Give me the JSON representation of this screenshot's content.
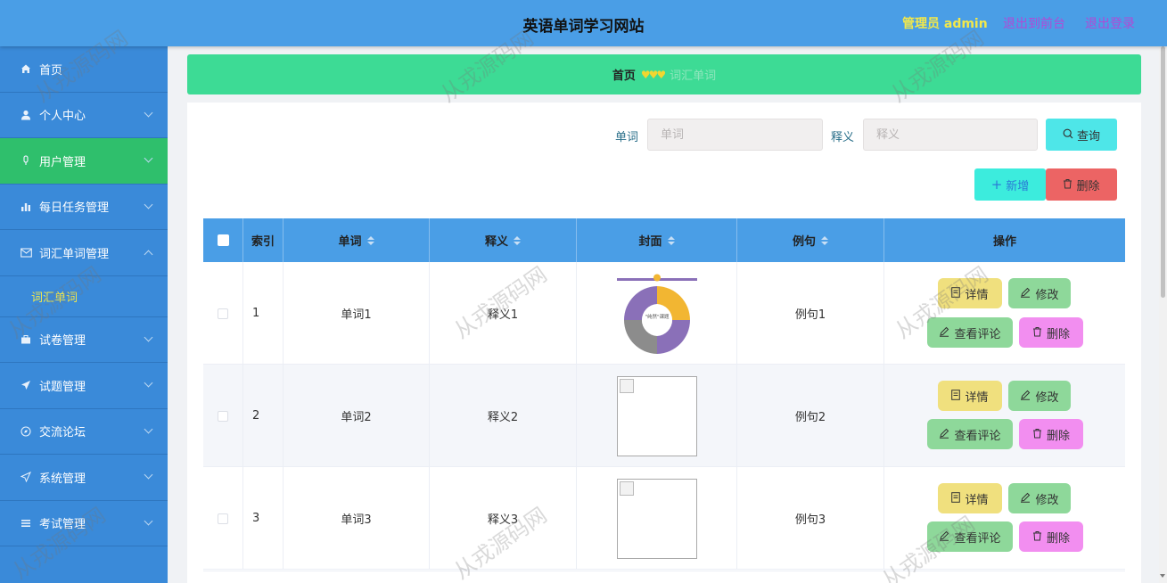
{
  "header": {
    "title": "英语单词学习网站",
    "admin": "管理员 admin",
    "back_front": "退出到前台",
    "logout": "退出登录"
  },
  "sidebar": {
    "items": [
      {
        "label": "首页",
        "icon": "home-icon"
      },
      {
        "label": "个人中心",
        "icon": "user-icon"
      },
      {
        "label": "用户管理",
        "icon": "microphone-icon"
      },
      {
        "label": "每日任务管理",
        "icon": "bar-chart-icon"
      },
      {
        "label": "词汇单词管理",
        "icon": "mail-icon"
      },
      {
        "label": "试卷管理",
        "icon": "briefcase-icon"
      },
      {
        "label": "试题管理",
        "icon": "send-icon"
      },
      {
        "label": "交流论坛",
        "icon": "compass-icon"
      },
      {
        "label": "系统管理",
        "icon": "paper-plane-icon"
      },
      {
        "label": "考试管理",
        "icon": "list-icon"
      }
    ],
    "sub_item": "词汇单词"
  },
  "breadcrumb": {
    "home": "首页",
    "separator": "♥♥♥",
    "current": "词汇单词"
  },
  "search": {
    "word_label": "单词",
    "word_placeholder": "单词",
    "meaning_label": "释义",
    "meaning_placeholder": "释义",
    "query_button": "查询"
  },
  "actions": {
    "add": "新增",
    "delete": "删除"
  },
  "table": {
    "columns": [
      "索引",
      "单词",
      "释义",
      "封面",
      "例句",
      "操作"
    ],
    "rows": [
      {
        "index": "1",
        "word": "单词1",
        "meaning": "释义1",
        "example": "例句1"
      },
      {
        "index": "2",
        "word": "单词2",
        "meaning": "释义2",
        "example": "例句2"
      },
      {
        "index": "3",
        "word": "单词3",
        "meaning": "释义3",
        "example": "例句3"
      }
    ],
    "ops": {
      "detail": "详情",
      "edit": "修改",
      "comments": "查看评论",
      "remove": "删除"
    }
  },
  "cover_image": {
    "center_text": "\"纯然\"课题",
    "colors": [
      "#f2b632",
      "#8a70b8",
      "#8c8c8c"
    ]
  },
  "watermark": "从戎源码网",
  "colors": {
    "header": "#4a9ee6",
    "sidebar": "#3a8ad9",
    "active_nav": "#2fbf6c",
    "breadcrumb_bar": "#3ddb95"
  }
}
